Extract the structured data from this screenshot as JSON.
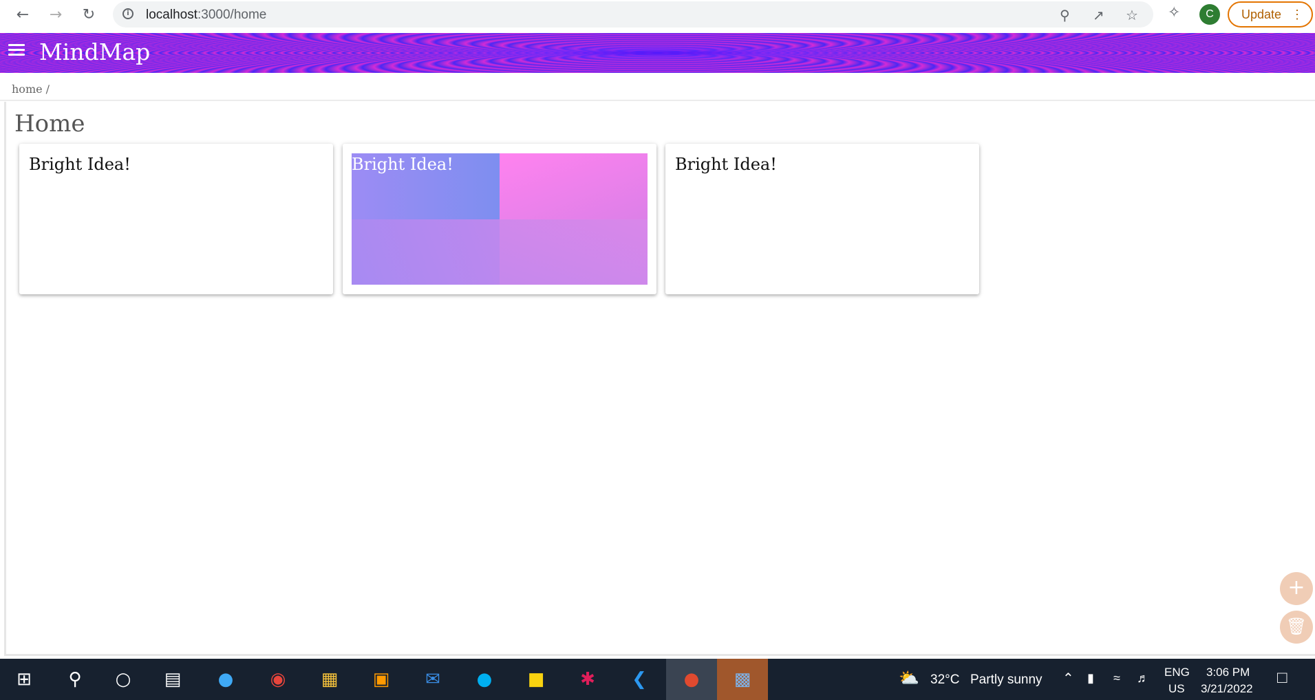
{
  "browser": {
    "url_host": "localhost",
    "url_path": ":3000/home",
    "update_label": "Update",
    "avatar_letter": "C"
  },
  "appbar": {
    "title": "MindMap"
  },
  "breadcrumb": "home /",
  "page_title": "Home",
  "cards": [
    {
      "text": "Bright Idea!"
    },
    {
      "text": "Bright Idea!"
    },
    {
      "text": "Bright Idea!"
    }
  ],
  "fabs": {
    "add_icon": "plus-icon",
    "delete_icon": "trash-icon"
  },
  "taskbar": {
    "weather_temp": "32°C",
    "weather_text": "Partly sunny",
    "lang_line1": "ENG",
    "lang_line2": "US",
    "time": "3:06 PM",
    "date": "3/21/2022"
  }
}
